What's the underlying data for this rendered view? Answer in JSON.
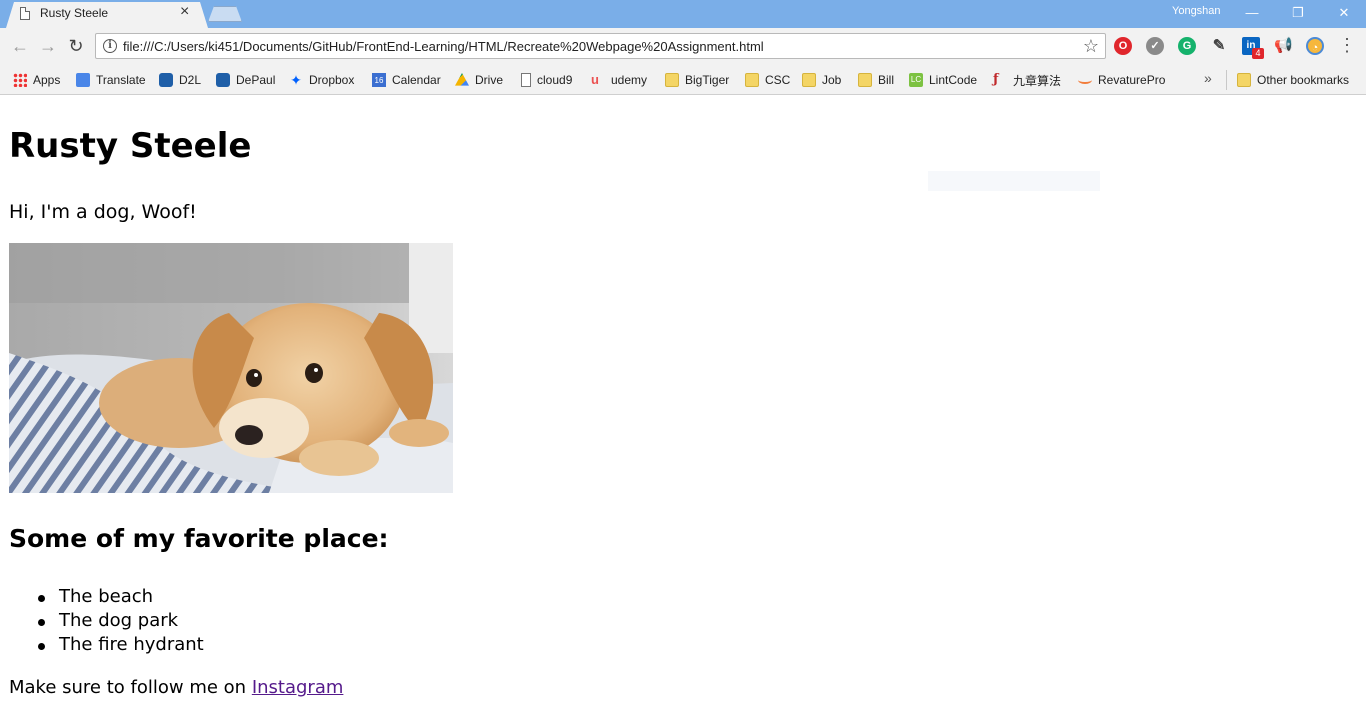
{
  "browser": {
    "tab_title": "Rusty Steele",
    "profile_name": "Yongshan",
    "url": "file:///C:/Users/ki451/Documents/GitHub/FrontEnd-Learning/HTML/Recreate%20Webpage%20Assignment.html",
    "extension_badge": "4",
    "bookmarks": [
      {
        "label": "Apps",
        "icon": "apps-grid-icon"
      },
      {
        "label": "Translate",
        "icon": "translate-icon"
      },
      {
        "label": "D2L",
        "icon": "d2l-icon"
      },
      {
        "label": "DePaul",
        "icon": "depaul-icon"
      },
      {
        "label": "Dropbox",
        "icon": "dropbox-icon"
      },
      {
        "label": "Calendar",
        "icon": "calendar-icon",
        "icon_text": "16"
      },
      {
        "label": "Drive",
        "icon": "drive-icon"
      },
      {
        "label": "cloud9",
        "icon": "page-icon"
      },
      {
        "label": "udemy",
        "icon": "udemy-icon"
      },
      {
        "label": "BigTiger",
        "icon": "folder-icon"
      },
      {
        "label": "CSC",
        "icon": "folder-icon"
      },
      {
        "label": "Job",
        "icon": "folder-icon"
      },
      {
        "label": "Bill",
        "icon": "folder-icon"
      },
      {
        "label": "LintCode",
        "icon": "lintcode-icon",
        "icon_text": "LC"
      },
      {
        "label": "九章算法",
        "icon": "jiuzhang-icon"
      },
      {
        "label": "RevaturePro",
        "icon": "revature-icon"
      }
    ],
    "other_bookmarks": "Other bookmarks"
  },
  "page": {
    "heading": "Rusty Steele",
    "intro": "Hi, I'm a dog, Woof!",
    "places_heading": "Some of my favorite place:",
    "places": [
      "The beach",
      "The dog park",
      "The fire hydrant"
    ],
    "follow_text": "Make sure to follow me on ",
    "follow_link": "Instagram"
  },
  "colors": {
    "titlebar": "#7aaee8",
    "toolbar": "#f2f2f2",
    "link_visited": "#551a8b"
  }
}
